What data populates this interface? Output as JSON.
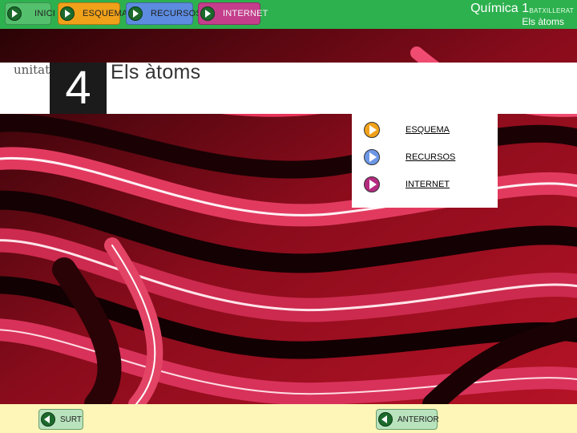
{
  "nav": {
    "inici": "INICI",
    "esquema": "ESQUEMA",
    "recursos": "RECURSOS",
    "internet": "INTERNET"
  },
  "header": {
    "title": "Química 1",
    "level": "BATXILLERAT",
    "subtitle": "Els àtoms"
  },
  "unit": {
    "word": "unitat",
    "number": "4",
    "title": "Els àtoms"
  },
  "menu": {
    "items": [
      {
        "label": "ESQUEMA",
        "icon": "play-orange-icon"
      },
      {
        "label": "RECURSOS",
        "icon": "play-blue-icon"
      },
      {
        "label": "INTERNET",
        "icon": "play-purple-icon"
      }
    ]
  },
  "footer": {
    "exit": "SURT",
    "previous": "ANTERIOR"
  },
  "colors": {
    "topbar": "#2db04e",
    "bottombar": "#fdf6b8",
    "esquema": "#f0a11a",
    "recursos": "#5c8be0",
    "internet": "#c43e8c",
    "photo_base": "#7a0814"
  },
  "background_image": "red-black-striped-photo"
}
